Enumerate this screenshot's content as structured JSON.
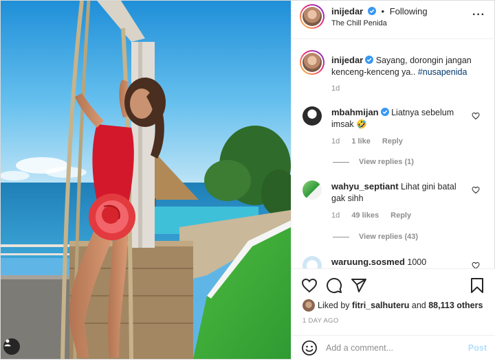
{
  "header": {
    "username": "inijedar",
    "dot": "•",
    "follow_label": "Following",
    "location": "The Chill Penida",
    "more_label": "···"
  },
  "caption": {
    "username": "inijedar",
    "text": "Sayang, dorongin jangan kenceng-kenceng ya..",
    "hashtag": "#nusapenida",
    "time": "1d"
  },
  "comments": [
    {
      "username": "mbahmijan",
      "verified": true,
      "text": "Liatnya sebelum imsak 🤣",
      "time": "1d",
      "likes": "1 like",
      "reply_label": "Reply",
      "view_replies": "View replies (1)"
    },
    {
      "username": "wahyu_septiant",
      "verified": false,
      "text": "Lihat gini batal gak sihh",
      "time": "1d",
      "likes": "49 likes",
      "reply_label": "Reply",
      "view_replies": "View replies (43)"
    },
    {
      "username": "waruung.sosmed",
      "verified": false,
      "text": "1000"
    }
  ],
  "likes": {
    "prefix": "Liked by",
    "user": "fitri_salhuteru",
    "middle": "and",
    "count": "88,113 others"
  },
  "posted_ago": "1 DAY AGO",
  "comment_box": {
    "placeholder": "Add a comment...",
    "post_label": "Post"
  },
  "icons": {
    "like": "heart-icon",
    "comment": "comment-icon",
    "share": "share-icon",
    "save": "bookmark-icon",
    "emoji": "smile-icon",
    "verified": "verified-badge-icon"
  },
  "colors": {
    "link": "#00376b",
    "verified": "#3897f0",
    "muted": "#8e8e8e",
    "post_disabled": "#b2dffc",
    "grass": "#3aa83a",
    "sky": "#4fb0e8",
    "sea": "#2a8fc4",
    "swimsuit": "#d3182b"
  }
}
